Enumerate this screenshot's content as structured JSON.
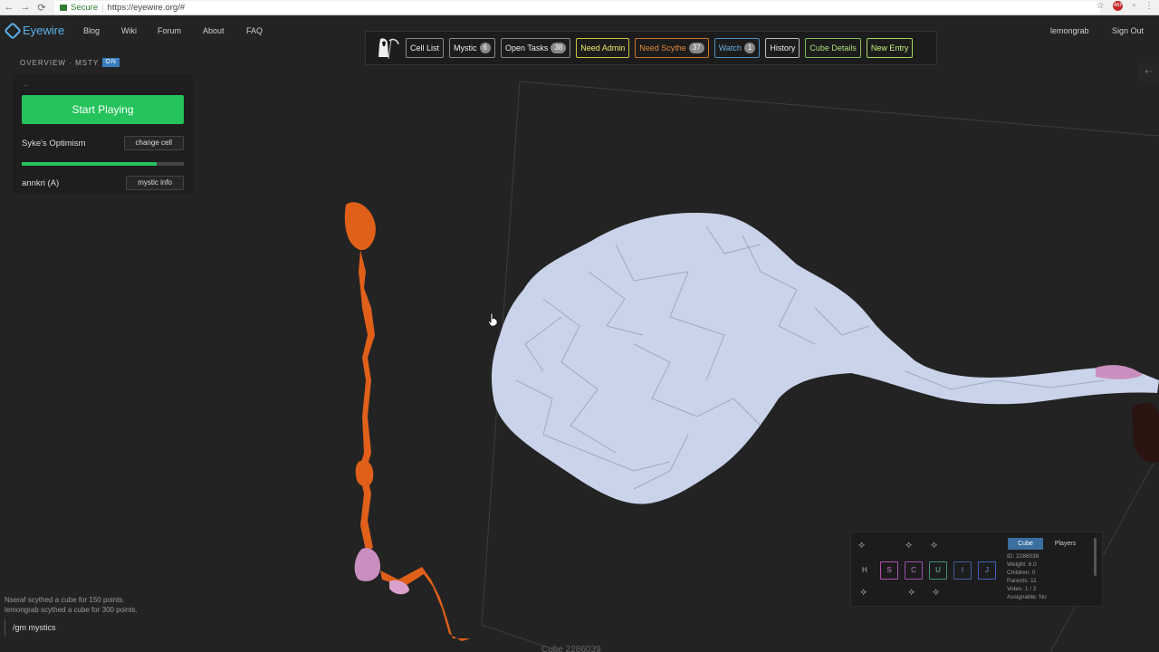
{
  "browser": {
    "secure_label": "Secure",
    "url": "https://eyewire.org/#"
  },
  "nav": {
    "logo_text": "Eyewire",
    "links": [
      "Blog",
      "Wiki",
      "Forum",
      "About",
      "FAQ"
    ],
    "username": "lemongrab",
    "sign_out": "Sign Out"
  },
  "toolbar": {
    "buttons": [
      {
        "label": "Cell List"
      },
      {
        "label": "Mystic",
        "count": "6"
      },
      {
        "label": "Open Tasks",
        "count": "38"
      },
      {
        "label": "Need Admin"
      },
      {
        "label": "Need Scythe",
        "count": "37"
      },
      {
        "label": "Watch",
        "count": "1"
      },
      {
        "label": "History"
      },
      {
        "label": "Cube Details"
      },
      {
        "label": "New Entry"
      }
    ]
  },
  "overview": {
    "title": "OVERVIEW · MSTY",
    "status": "ON",
    "back_arrow": "←",
    "start_button": "Start Playing",
    "cell_name": "Syke's Optimism",
    "change_cell": "change cell",
    "progress": 0.83,
    "mystic_name": "annkri (A)",
    "mystic_info": "mystic info"
  },
  "chat": {
    "messages": [
      "Nseraf scythed a cube for 150 points.",
      "lemongrab scythed a cube for 300 points."
    ],
    "input_value": "/gm mystics"
  },
  "footer": {
    "cube_label": "Cube 2286039"
  },
  "cube_panel": {
    "hotkeys": [
      "S",
      "C",
      "U",
      "I",
      "J"
    ],
    "hotkey_h": "H",
    "tab_cube": "Cube",
    "tab_players": "Players",
    "info": [
      "ID: 2286039",
      "Weight: 6.0",
      "Children: 0",
      "Parents: 11",
      "Votes: 1 / 2",
      "Assignable: No"
    ]
  },
  "colors": {
    "accent_green": "#25c35c",
    "logo_blue": "#5bb3ea",
    "cell_white": "#c9d3ea",
    "cell_orange": "#e0601a"
  }
}
